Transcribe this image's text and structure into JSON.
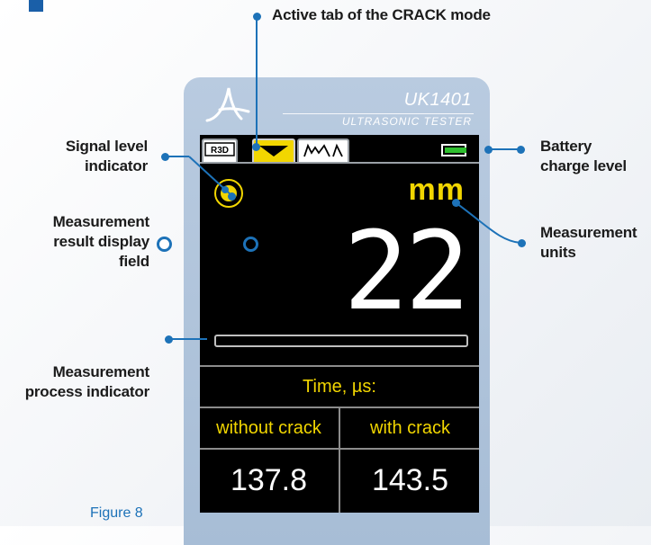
{
  "annotations": {
    "active_tab": "Active tab of the CRACK mode",
    "signal_level": "Signal level indicator",
    "signal_level_lines": [
      "Signal level",
      "indicator"
    ],
    "result_field_lines": [
      "Measurement",
      "result display",
      "field"
    ],
    "process_indicator_lines": [
      "Measurement",
      "process indicator"
    ],
    "battery_lines": [
      "Battery",
      "charge level"
    ],
    "units_lines": [
      "Measurement",
      "units"
    ]
  },
  "device": {
    "model": "UK1401",
    "subtitle": "ULTRASONIC TESTER"
  },
  "screen": {
    "tabs": [
      "R3D",
      "CRACK",
      "WAVE"
    ],
    "active_tab": "CRACK",
    "units": "mm",
    "reading": "22",
    "battery_level": 1.0,
    "progress": 0.0,
    "time_title": "Time, µs:",
    "columns": [
      {
        "label": "without crack",
        "value": "137.8"
      },
      {
        "label": "with crack",
        "value": "143.5"
      }
    ]
  },
  "colors": {
    "accent_blue": "#1d72b8",
    "screen_yellow": "#f2d600",
    "battery_green": "#2fbf2f"
  },
  "caption": "Figure 8"
}
